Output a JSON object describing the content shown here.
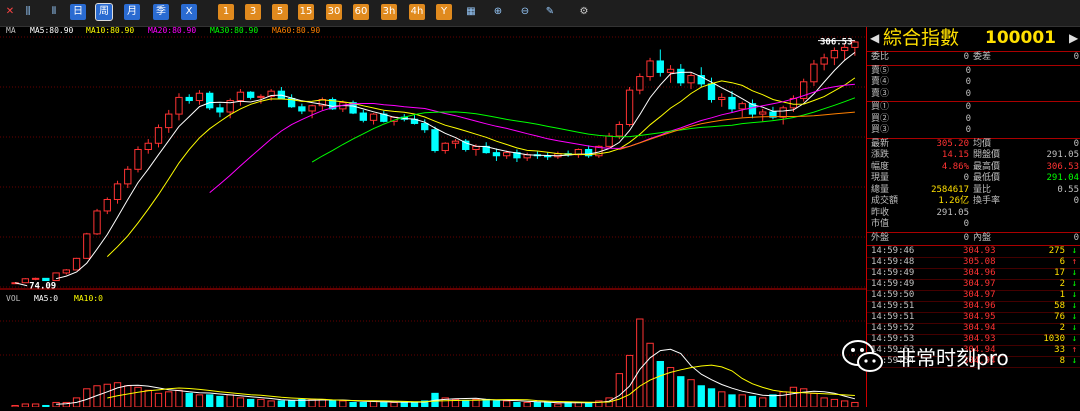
{
  "toolbar": {
    "period_buttons": [
      "日",
      "周",
      "月",
      "季",
      "X"
    ],
    "selected_period": "周",
    "num_buttons": [
      "1",
      "3",
      "5",
      "15",
      "30",
      "60",
      "3h",
      "4h",
      "Y"
    ]
  },
  "ma_legend": {
    "ma_label": "MA",
    "ma5": "MA5:80.90",
    "ma10": "MA10:80.90",
    "ma20": "MA20:80.90",
    "ma30": "MA30:80.90",
    "ma60": "MA60:80.90"
  },
  "vol_legend": {
    "vol": "VOL",
    "ma5": "MA5:0",
    "ma10": "MA10:0"
  },
  "chart_data": {
    "type": "candlestick",
    "high_label": "306.53",
    "low_label": "74.09",
    "colors": {
      "up": "#ff3333",
      "down": "#00ffff",
      "ma5": "#ffffff",
      "ma10": "#ffff00",
      "ma20": "#ff00ff",
      "ma30": "#00ff00",
      "ma60": "#ff8000"
    },
    "candles": [
      [
        74.1,
        74.1,
        74.1,
        74.1
      ],
      [
        74.1,
        78.5,
        74.1,
        77.9
      ],
      [
        77.9,
        79,
        76.5,
        78.3
      ],
      [
        78.3,
        78.6,
        75.8,
        76.2
      ],
      [
        76.2,
        84,
        76,
        83.5
      ],
      [
        83.5,
        87.2,
        82,
        86.4
      ],
      [
        86.4,
        98,
        86,
        97.5
      ],
      [
        97.5,
        122,
        97,
        121
      ],
      [
        121,
        145,
        120,
        143
      ],
      [
        143,
        156,
        140,
        154
      ],
      [
        154,
        172,
        150,
        169
      ],
      [
        169,
        186,
        165,
        183
      ],
      [
        183,
        205,
        180,
        202
      ],
      [
        202,
        212,
        198,
        208
      ],
      [
        208,
        226,
        204,
        223
      ],
      [
        223,
        240,
        218,
        236
      ],
      [
        236,
        256,
        230,
        252
      ],
      [
        252,
        255,
        246,
        249
      ],
      [
        249,
        259,
        245,
        256
      ],
      [
        256,
        258,
        240,
        242
      ],
      [
        242,
        246,
        233,
        238
      ],
      [
        238,
        251,
        232,
        249
      ],
      [
        249,
        260,
        244,
        257
      ],
      [
        257,
        258,
        250,
        252
      ],
      [
        252,
        255,
        246,
        253
      ],
      [
        253,
        260,
        249,
        258
      ],
      [
        258,
        262,
        250,
        251
      ],
      [
        251,
        255,
        242,
        243
      ],
      [
        243,
        246,
        236,
        239
      ],
      [
        239,
        245,
        232,
        244
      ],
      [
        244,
        252,
        240,
        250
      ],
      [
        250,
        252,
        240,
        241
      ],
      [
        241,
        249,
        238,
        247
      ],
      [
        247,
        249,
        236,
        237
      ],
      [
        237,
        240,
        228,
        230
      ],
      [
        230,
        237,
        226,
        236
      ],
      [
        236,
        239,
        228,
        229
      ],
      [
        229,
        234,
        225,
        233
      ],
      [
        233,
        236,
        229,
        231
      ],
      [
        231,
        235,
        226,
        227
      ],
      [
        227,
        231,
        218,
        221
      ],
      [
        221,
        224,
        199,
        201
      ],
      [
        201,
        209,
        198,
        208
      ],
      [
        208,
        212,
        203,
        210
      ],
      [
        210,
        212,
        200,
        202
      ],
      [
        202,
        207,
        196,
        205
      ],
      [
        205,
        209,
        198,
        199
      ],
      [
        199,
        203,
        191,
        196
      ],
      [
        196,
        201,
        193,
        199
      ],
      [
        199,
        202,
        190,
        194
      ],
      [
        194,
        199,
        191,
        197
      ],
      [
        197,
        200,
        193,
        196
      ],
      [
        196,
        199,
        192,
        195
      ],
      [
        195,
        200,
        193,
        198
      ],
      [
        198,
        201,
        195,
        197
      ],
      [
        197,
        203,
        194,
        202
      ],
      [
        202,
        206,
        194,
        196
      ],
      [
        196,
        206,
        194,
        205
      ],
      [
        205,
        218,
        203,
        215
      ],
      [
        215,
        229,
        212,
        226
      ],
      [
        226,
        262,
        224,
        259
      ],
      [
        259,
        275,
        255,
        272
      ],
      [
        272,
        290,
        268,
        287
      ],
      [
        287,
        298,
        272,
        276
      ],
      [
        276,
        283,
        266,
        279
      ],
      [
        279,
        284,
        263,
        266
      ],
      [
        266,
        276,
        260,
        273
      ],
      [
        273,
        281,
        262,
        265
      ],
      [
        265,
        271,
        247,
        250
      ],
      [
        250,
        256,
        243,
        252
      ],
      [
        252,
        258,
        238,
        241
      ],
      [
        241,
        248,
        233,
        246
      ],
      [
        246,
        250,
        232,
        236
      ],
      [
        236,
        241,
        229,
        238
      ],
      [
        238,
        243,
        231,
        233
      ],
      [
        233,
        244,
        226,
        242
      ],
      [
        242,
        254,
        238,
        251
      ],
      [
        251,
        270,
        248,
        267
      ],
      [
        267,
        288,
        263,
        284
      ],
      [
        284,
        294,
        278,
        290
      ],
      [
        290,
        300,
        283,
        297
      ],
      [
        297,
        304,
        288,
        300
      ],
      [
        300,
        306.5,
        292,
        305.2
      ]
    ],
    "volumes": [
      1,
      2,
      2,
      1,
      3,
      3,
      6,
      12,
      14,
      15,
      16,
      14,
      13,
      11,
      9,
      10,
      11,
      9,
      8,
      8,
      7,
      8,
      6,
      5,
      5,
      4,
      4,
      4,
      5,
      5,
      5,
      4,
      4,
      3,
      3,
      4,
      3,
      3,
      3,
      3,
      4,
      9,
      6,
      5,
      4,
      5,
      5,
      4,
      4,
      3,
      3,
      3,
      3,
      2,
      3,
      3,
      3,
      4,
      6,
      22,
      34,
      58,
      42,
      30,
      26,
      20,
      18,
      14,
      12,
      10,
      8,
      8,
      7,
      6,
      8,
      10,
      13,
      12,
      9,
      6,
      5,
      4,
      3
    ],
    "vol_up_color": "#ff3333",
    "vol_down_color": "#00ffff"
  },
  "quote": {
    "name": "綜合指數",
    "code": "100001",
    "order_stats": [
      {
        "l": "委比",
        "v": "0",
        "l2": "委差",
        "v2": "0"
      }
    ],
    "sells": [
      {
        "l": "賣⑤",
        "v": "0"
      },
      {
        "l": "賣④",
        "v": "0"
      },
      {
        "l": "賣③",
        "v": "0"
      }
    ],
    "buys": [
      {
        "l": "買①",
        "v": "0"
      },
      {
        "l": "買②",
        "v": "0"
      },
      {
        "l": "買③",
        "v": "0"
      }
    ],
    "stats": [
      {
        "l": "最新",
        "v": "305.20",
        "c": "#ff3333",
        "l2": "均價",
        "v2": "0",
        "c2": "#c0c0c0"
      },
      {
        "l": "漲跌",
        "v": "14.15",
        "c": "#ff3333",
        "l2": "開盤價",
        "v2": "291.05",
        "c2": "#c0c0c0"
      },
      {
        "l": "幅度",
        "v": "4.86%",
        "c": "#ff3333",
        "l2": "最高價",
        "v2": "306.53",
        "c2": "#ff3333"
      },
      {
        "l": "現量",
        "v": "0",
        "c": "#c0c0c0",
        "l2": "最低價",
        "v2": "291.04",
        "c2": "#00ff00"
      },
      {
        "l": "總量",
        "v": "2584617",
        "c": "#ffe000",
        "l2": "量比",
        "v2": "0.55",
        "c2": "#c0c0c0"
      },
      {
        "l": "成交額",
        "v": "1.26亿",
        "c": "#ffe000",
        "l2": "換手率",
        "v2": "0",
        "c2": "#c0c0c0"
      },
      {
        "l": "昨收",
        "v": "291.05",
        "c": "#c0c0c0",
        "l2": "",
        "v2": "",
        "c2": "#c0c0c0"
      },
      {
        "l": "市值",
        "v": "0",
        "c": "#c0c0c0",
        "l2": "",
        "v2": "",
        "c2": "#c0c0c0"
      }
    ],
    "outer_inner": {
      "l": "外盤",
      "v": "0",
      "l2": "內盤",
      "v2": "0"
    },
    "ticks": [
      {
        "t": "14:59:46",
        "p": "304.93",
        "q": "275",
        "d": "↓"
      },
      {
        "t": "14:59:48",
        "p": "305.08",
        "q": "6",
        "d": "↑"
      },
      {
        "t": "14:59:49",
        "p": "304.96",
        "q": "17",
        "d": "↓"
      },
      {
        "t": "14:59:49",
        "p": "304.97",
        "q": "2",
        "d": "↓"
      },
      {
        "t": "14:59:50",
        "p": "304.97",
        "q": "1",
        "d": "↓"
      },
      {
        "t": "14:59:51",
        "p": "304.96",
        "q": "58",
        "d": "↓"
      },
      {
        "t": "14:59:51",
        "p": "304.95",
        "q": "76",
        "d": "↓"
      },
      {
        "t": "14:59:52",
        "p": "304.94",
        "q": "2",
        "d": "↓"
      },
      {
        "t": "14:59:53",
        "p": "304.93",
        "q": "1030",
        "d": "↓"
      },
      {
        "t": "14:59:53",
        "p": "304.94",
        "q": "33",
        "d": "↑"
      },
      {
        "t": "14:59:54",
        "p": "304.94",
        "q": "8",
        "d": "↓"
      }
    ]
  },
  "watermark": {
    "text": "非常时刻pro"
  }
}
